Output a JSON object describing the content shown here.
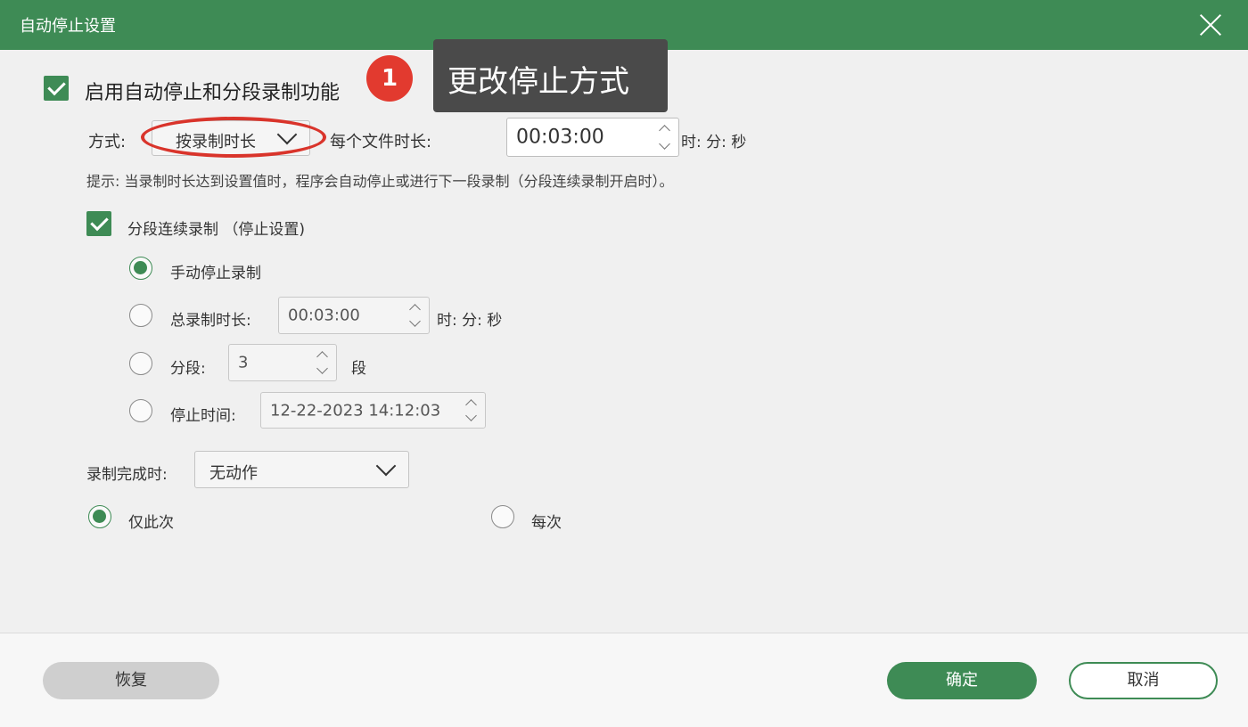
{
  "window": {
    "title": "自动停止设置"
  },
  "main": {
    "enable_label": "启用自动停止和分段录制功能",
    "mode_label": "方式:",
    "mode_value": "按录制时长",
    "file_duration_label": "每个文件时长:",
    "file_duration_value": "00:03:00",
    "file_duration_unit": "时: 分: 秒",
    "hint": "提示: 当录制时长达到设置值时，程序会自动停止或进行下一段录制（分段连续录制开启时）。",
    "segment_label": "分段连续录制 （停止设置)",
    "options": {
      "manual_label": "手动停止录制",
      "total_label": "总录制时长:",
      "total_value": "00:03:00",
      "total_unit": "时: 分: 秒",
      "segments_label": "分段:",
      "segments_value": "3",
      "segments_unit": "段",
      "stop_time_label": "停止时间:",
      "stop_time_value": "12-22-2023 14:12:03"
    },
    "on_complete_label": "录制完成时:",
    "on_complete_value": "无动作",
    "once_label": "仅此次",
    "every_label": "每次"
  },
  "annotation": {
    "number": "1",
    "callout": "更改停止方式"
  },
  "footer": {
    "restore_label": "恢复",
    "ok_label": "确定",
    "cancel_label": "取消"
  },
  "colors": {
    "accent": "#3e8b55",
    "annotation_red": "#e23a2f",
    "callout_bg": "#4a4a4a"
  }
}
